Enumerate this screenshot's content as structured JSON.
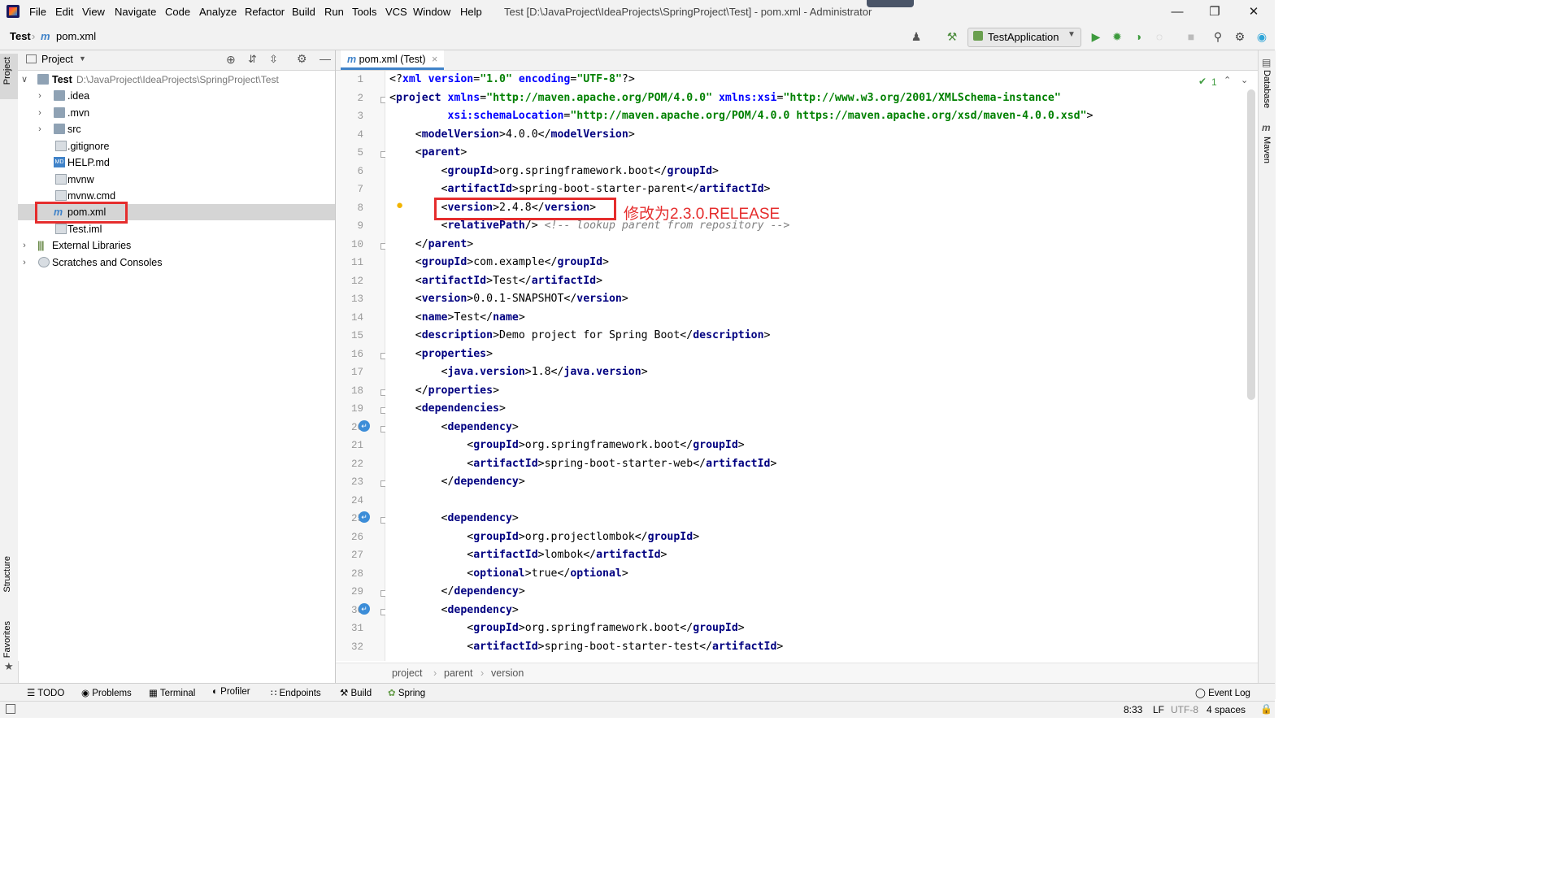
{
  "menubar": {
    "items": [
      "File",
      "Edit",
      "View",
      "Navigate",
      "Code",
      "Analyze",
      "Refactor",
      "Build",
      "Run",
      "Tools",
      "VCS",
      "Window",
      "Help"
    ],
    "window_title": "Test [D:\\JavaProject\\IdeaProjects\\SpringProject\\Test] - pom.xml - Administrator"
  },
  "navbar": {
    "project": "Test",
    "file": "pom.xml",
    "run_config": "TestApplication"
  },
  "left_stripe": {
    "project": "Project",
    "structure": "Structure",
    "favorites": "Favorites"
  },
  "right_stripe": {
    "database": "Database",
    "maven": "Maven"
  },
  "project_panel": {
    "title": "Project",
    "root_name": "Test",
    "root_path": "D:\\JavaProject\\IdeaProjects\\SpringProject\\Test",
    "items": [
      ".idea",
      ".mvn",
      "src",
      ".gitignore",
      "HELP.md",
      "mvnw",
      "mvnw.cmd",
      "pom.xml",
      "Test.iml"
    ],
    "external_libraries": "External Libraries",
    "scratches": "Scratches and Consoles"
  },
  "editor": {
    "tab_label": "pom.xml (Test)",
    "inspection_count": "1",
    "line_numbers": [
      "1",
      "2",
      "3",
      "4",
      "5",
      "6",
      "7",
      "8",
      "9",
      "10",
      "11",
      "12",
      "13",
      "14",
      "15",
      "16",
      "17",
      "18",
      "19",
      "20",
      "21",
      "22",
      "23",
      "24",
      "25",
      "26",
      "27",
      "28",
      "29",
      "30",
      "31",
      "32"
    ],
    "annotation": "修改为2.3.0.RELEASE",
    "breadcrumb": [
      "project",
      "parent",
      "version"
    ]
  },
  "bottom_tabs": [
    "TODO",
    "Problems",
    "Terminal",
    "Profiler",
    "Endpoints",
    "Build",
    "Spring"
  ],
  "event_log": "Event Log",
  "status": {
    "position": "8:33",
    "line_sep": "LF",
    "encoding": "UTF-8",
    "indent": "4 spaces"
  },
  "colors": {
    "accent": "#4083c9",
    "annotation_red": "#e52d2d",
    "selection": "#a6d2ff",
    "current_line": "#fffae3"
  }
}
